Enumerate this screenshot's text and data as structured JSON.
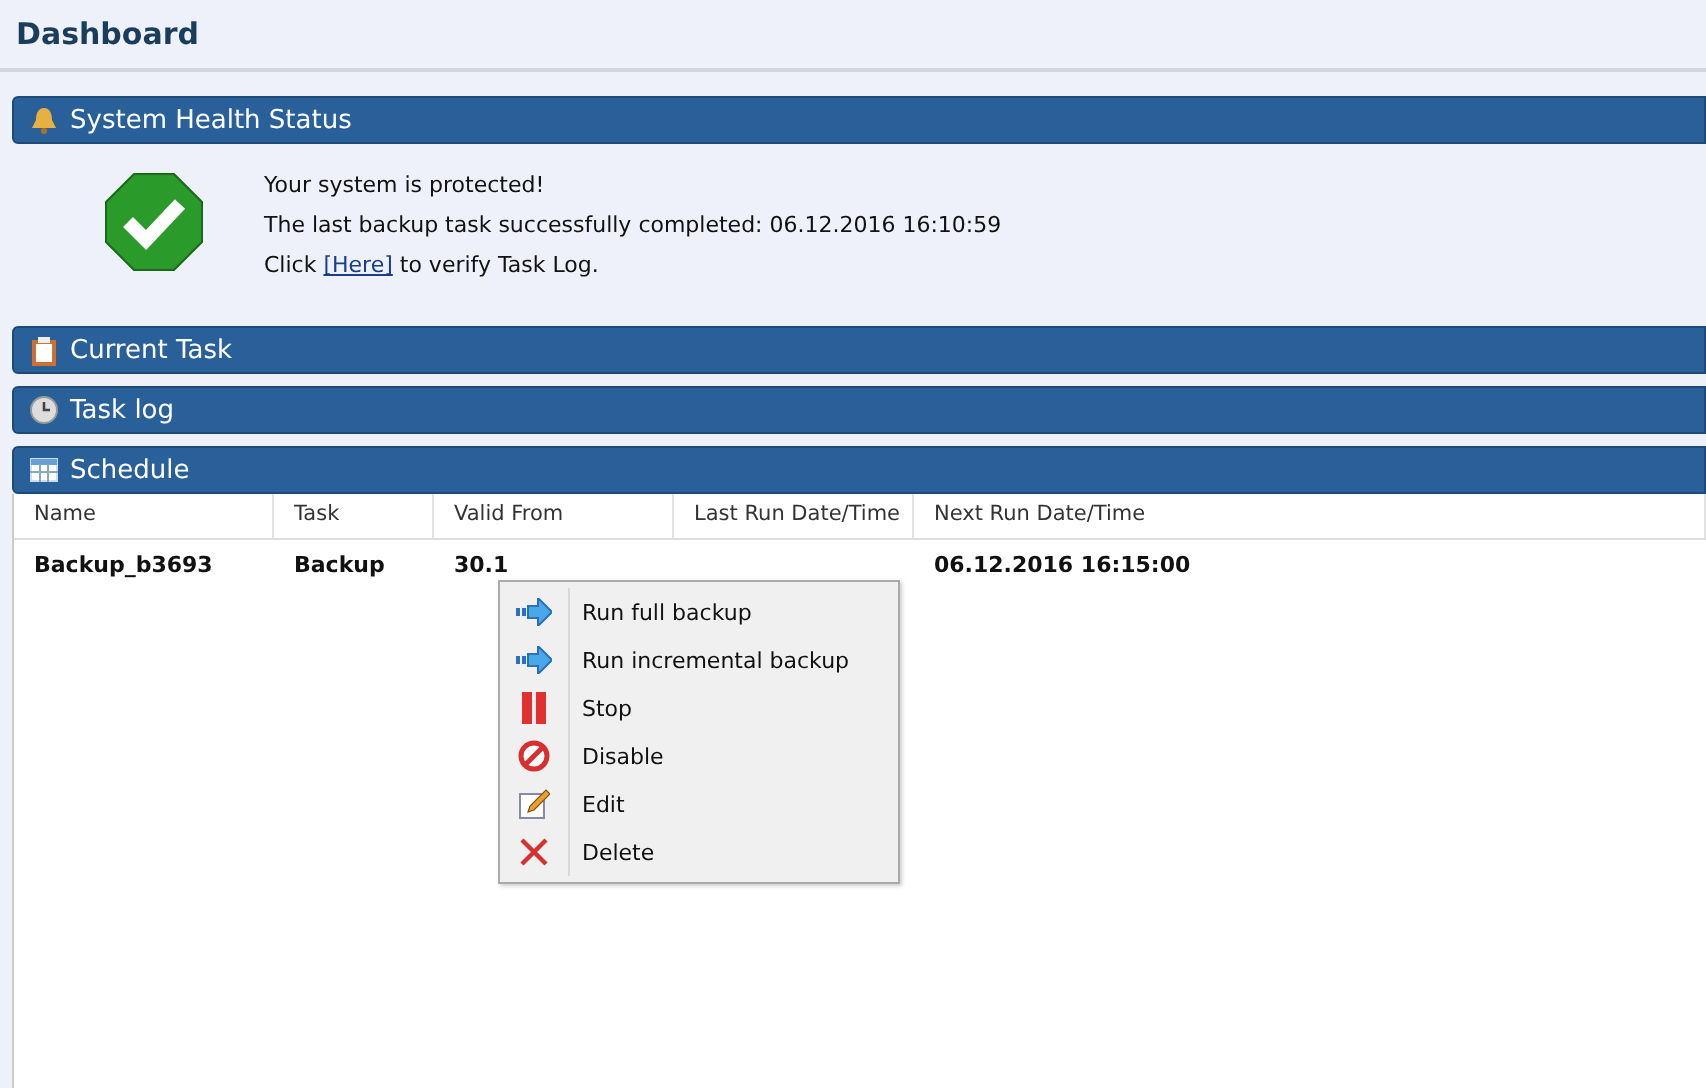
{
  "page_title": "Dashboard",
  "sections": [
    {
      "kind": "health",
      "title": "System Health Status",
      "lines": [
        "Your system is protected!",
        "The last backup task successfully completed: 06.12.2016 16:10:59"
      ],
      "link_line": {
        "before": "Click",
        "link": "[Here]",
        "after": "to verify Task Log."
      }
    },
    {
      "kind": "bar",
      "title": "Current Task"
    },
    {
      "kind": "bar",
      "title": "Task log"
    },
    {
      "kind": "schedule",
      "title": "Schedule"
    }
  ],
  "table": {
    "columns": [
      "Name",
      "Task",
      "Valid From",
      "Last Run Date/Time",
      "Next Run Date/Time"
    ],
    "rows": [
      {
        "name": "Backup_b3693",
        "task": "Backup",
        "valid_from": "30.1",
        "next_run": "06.12.2016 16:15:00"
      }
    ]
  },
  "context_menu": [
    {
      "label": "Run full backup"
    },
    {
      "label": "Run incremental backup"
    },
    {
      "label": "Stop"
    },
    {
      "label": "Disable"
    },
    {
      "label": "Edit"
    },
    {
      "label": "Delete"
    }
  ]
}
